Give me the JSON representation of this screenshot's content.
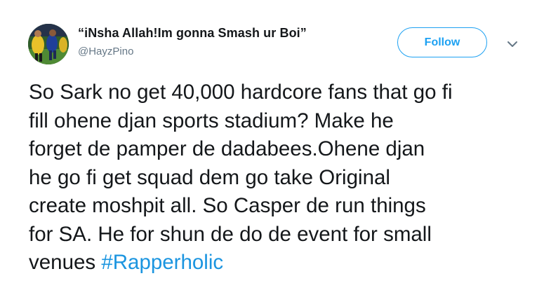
{
  "user": {
    "display_name": "“iNsha Allah!Im gonna Smash ur Boi”",
    "handle": "@HayzPino"
  },
  "actions": {
    "follow_label": "Follow",
    "menu_icon": "chevron-down-icon"
  },
  "tweet": {
    "lines": [
      "So Sark no get 40,000 hardcore fans that go fi",
      "fill ohene djan sports stadium? Make he",
      "forget de pamper de dadabees.Ohene djan",
      "he go fi get squad dem go take Original",
      "create moshpit all. So Casper de run things",
      "for SA. He for shun de do de event for small",
      "venues "
    ],
    "hashtag": "#Rapperholic"
  },
  "colors": {
    "accent": "#1da1f2",
    "hashtag": "#1b95e0",
    "text": "#14171a",
    "secondary": "#657786"
  }
}
